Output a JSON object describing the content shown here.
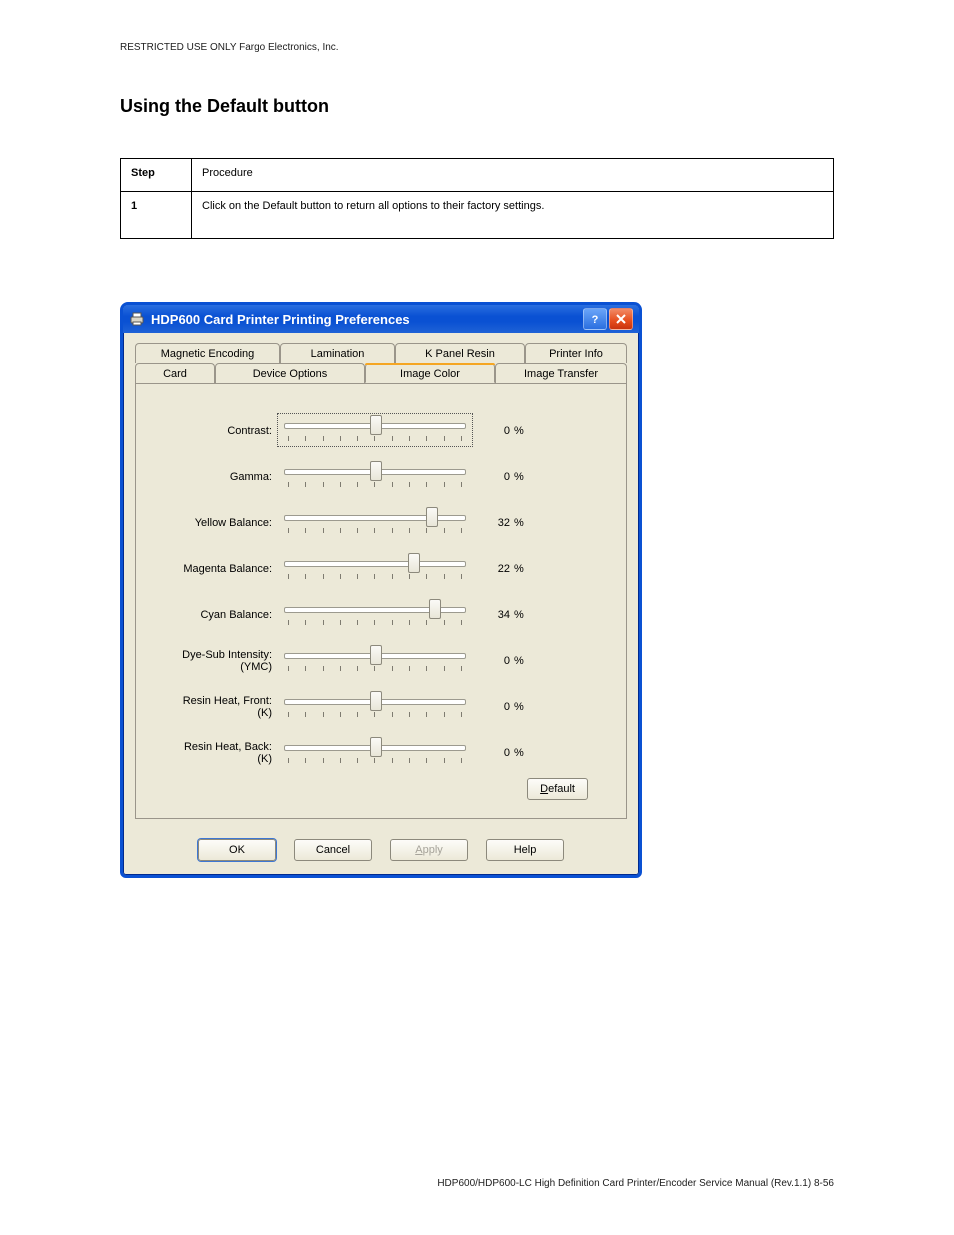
{
  "document": {
    "header": "RESTRICTED USE ONLY                                                                                                                                                    Fargo Electronics, Inc.",
    "section_title": "Using the Default button",
    "table": {
      "row1": {
        "step": "Step",
        "procedure": "Procedure"
      },
      "row2": {
        "step": "1",
        "procedure": "Click on the Default button to return all options to their factory settings."
      }
    },
    "page_number": "HDP600/HDP600-LC High Definition Card Printer/Encoder Service Manual (Rev.1.1)                                                                     8-56"
  },
  "dialog": {
    "title": "HDP600 Card Printer Printing Preferences",
    "help_btn": "?",
    "close_btn": "×",
    "tabs_top": [
      "Magnetic Encoding",
      "Lamination",
      "K Panel Resin",
      "Printer Info"
    ],
    "tabs_bottom": [
      "Card",
      "Device Options",
      "Image Color",
      "Image Transfer"
    ],
    "active_tab": "Image Color",
    "sliders": [
      {
        "label": "Contrast:",
        "sub": null,
        "value": 0,
        "min": -50,
        "max": 50,
        "focused": true
      },
      {
        "label": "Gamma:",
        "sub": null,
        "value": 0,
        "min": -50,
        "max": 50,
        "focused": false
      },
      {
        "label": "Yellow Balance:",
        "sub": null,
        "value": 32,
        "min": -50,
        "max": 50,
        "focused": false
      },
      {
        "label": "Magenta Balance:",
        "sub": null,
        "value": 22,
        "min": -50,
        "max": 50,
        "focused": false
      },
      {
        "label": "Cyan Balance:",
        "sub": null,
        "value": 34,
        "min": -50,
        "max": 50,
        "focused": false
      },
      {
        "label": "Dye-Sub Intensity:",
        "sub": "(YMC)",
        "value": 0,
        "min": -50,
        "max": 50,
        "focused": false
      },
      {
        "label": "Resin Heat, Front:",
        "sub": "(K)",
        "value": 0,
        "min": -50,
        "max": 50,
        "focused": false
      },
      {
        "label": "Resin Heat, Back:",
        "sub": "(K)",
        "value": 0,
        "min": -50,
        "max": 50,
        "focused": false
      }
    ],
    "percent": "%",
    "default_button": {
      "prefix": "D",
      "rest": "efault"
    },
    "footer": {
      "ok": "OK",
      "cancel": "Cancel",
      "apply": {
        "prefix": "A",
        "rest": "pply"
      },
      "help": "Help"
    }
  }
}
